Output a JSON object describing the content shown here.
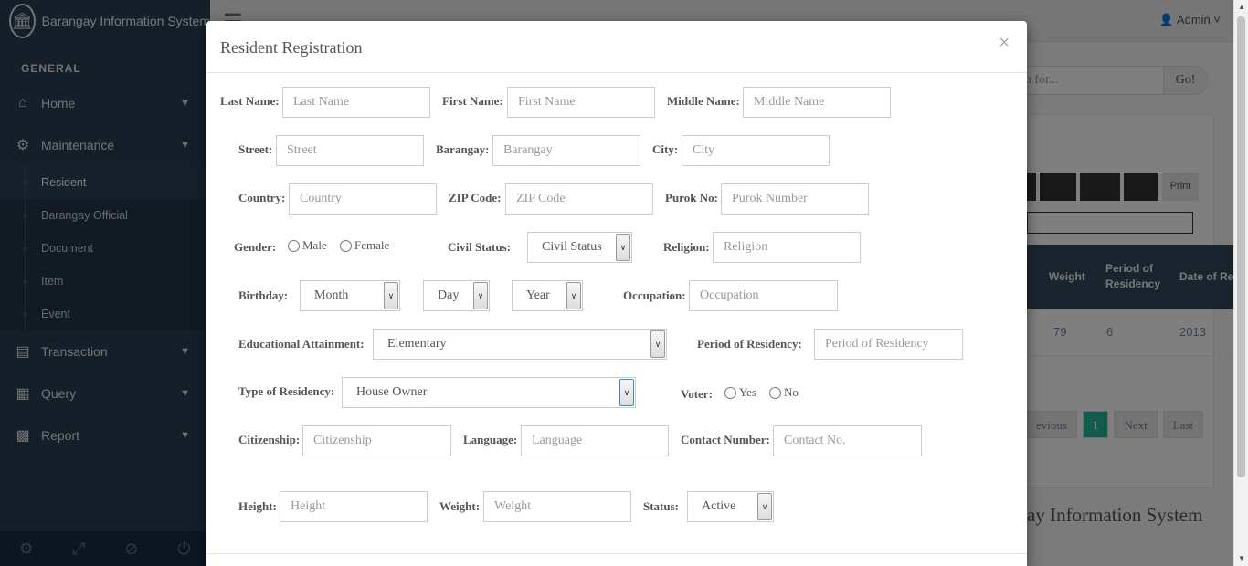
{
  "sidebar": {
    "brand": "Barangay Information System",
    "section_label": "GENERAL",
    "items": [
      {
        "label": "Home"
      },
      {
        "label": "Maintenance",
        "children": [
          "Resident",
          "Barangay Official",
          "Document",
          "Item",
          "Event"
        ]
      },
      {
        "label": "Transaction"
      },
      {
        "label": "Query"
      },
      {
        "label": "Report"
      }
    ]
  },
  "topnav": {
    "user": "Admin"
  },
  "background": {
    "search_placeholder": "rch for...",
    "search_button": "Go!",
    "print": "Print",
    "table_headers": [
      "Weight",
      "Period of Residency",
      "Date of Residency"
    ],
    "table_row": [
      "79",
      "6",
      "2013"
    ],
    "pager": [
      "evious",
      "1",
      "Next",
      "Last"
    ],
    "footer_title": "ay Information System"
  },
  "modal": {
    "title": "Resident Registration",
    "close": "×",
    "fields": {
      "last_name": {
        "label": "Last Name:",
        "placeholder": "Last Name"
      },
      "first_name": {
        "label": "First Name:",
        "placeholder": "First Name"
      },
      "middle_name": {
        "label": "Middle Name:",
        "placeholder": "Middle Name"
      },
      "street": {
        "label": "Street:",
        "placeholder": "Street"
      },
      "barangay": {
        "label": "Barangay:",
        "placeholder": "Barangay"
      },
      "city": {
        "label": "City:",
        "placeholder": "City"
      },
      "country": {
        "label": "Country:",
        "placeholder": "Country"
      },
      "zip": {
        "label": "ZIP Code:",
        "placeholder": "ZIP Code"
      },
      "purok": {
        "label": "Purok No:",
        "placeholder": "Purok Number"
      },
      "gender": {
        "label": "Gender:",
        "options": [
          "Male",
          "Female"
        ]
      },
      "civil_status": {
        "label": "Civil Status:",
        "value": "Civil Status"
      },
      "religion": {
        "label": "Religion:",
        "placeholder": "Religion"
      },
      "birthday": {
        "label": "Birthday:",
        "month": "Month",
        "day": "Day",
        "year": "Year"
      },
      "occupation": {
        "label": "Occupation:",
        "placeholder": "Occupation"
      },
      "education": {
        "label": "Educational Attainment:",
        "value": "Elementary"
      },
      "period_residency": {
        "label": "Period of Residency:",
        "placeholder": "Period of Residency"
      },
      "type_residency": {
        "label": "Type of Residency:",
        "value": "House Owner"
      },
      "voter": {
        "label": "Voter:",
        "options": [
          "Yes",
          "No"
        ]
      },
      "citizenship": {
        "label": "Citizenship:",
        "placeholder": "Citizenship"
      },
      "language": {
        "label": "Language:",
        "placeholder": "Language"
      },
      "contact": {
        "label": "Contact Number:",
        "placeholder": "Contact No."
      },
      "height": {
        "label": "Height:",
        "placeholder": "Height"
      },
      "weight": {
        "label": "Weight:",
        "placeholder": "Weight"
      },
      "status": {
        "label": "Status:",
        "value": "Active"
      }
    }
  }
}
